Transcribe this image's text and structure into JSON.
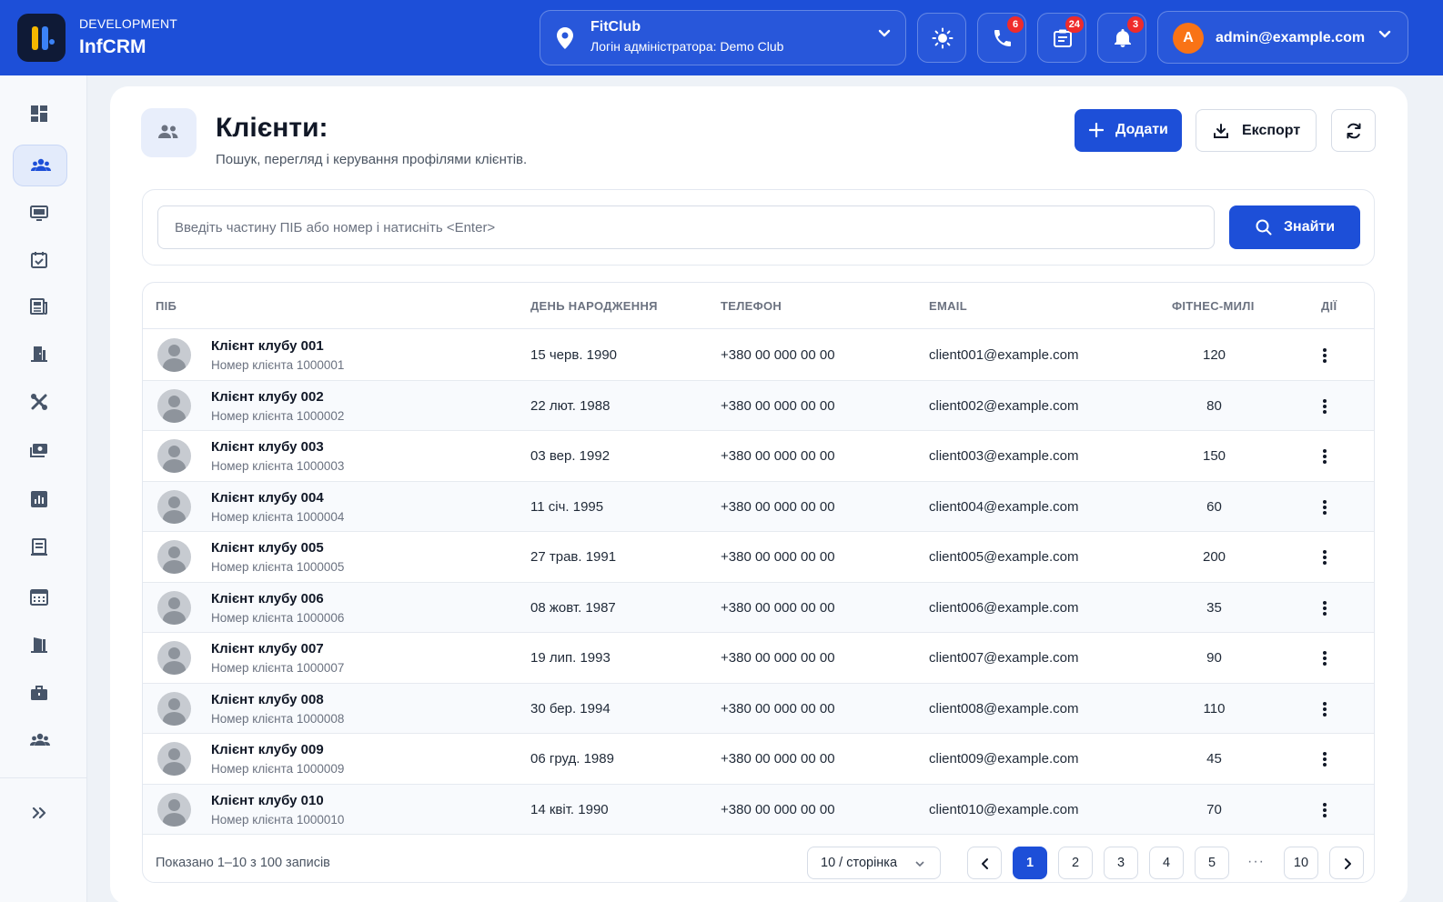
{
  "app": {
    "env_label": "DEVELOPMENT",
    "brand": "InfCRM"
  },
  "club_selector": {
    "name": "FitClub",
    "subtitle": "Логін адміністратора: Demo Club"
  },
  "header_actions": {
    "phone_badge": "6",
    "tasks_badge": "24",
    "notifications_badge": "3"
  },
  "user": {
    "initial": "A",
    "email": "admin@example.com"
  },
  "page": {
    "title": "Клієнти:",
    "subtitle": "Пошук, перегляд і керування профілями клієнтів.",
    "add_label": "Додати",
    "export_label": "Експорт"
  },
  "search": {
    "placeholder": "Введіть частину ПІБ або номер і натисніть <Enter>",
    "value": "",
    "button_label": "Знайти"
  },
  "table": {
    "columns": [
      "ПІБ",
      "ДЕНЬ НАРОДЖЕННЯ",
      "ТЕЛЕФОН",
      "EMAIL",
      "ФІТНЕС-МИЛІ",
      "ДІЇ"
    ],
    "rows": [
      {
        "name": "Клієнт клубу 001",
        "number": "Номер клієнта 1000001",
        "birthday": "15 черв. 1990",
        "phone": "+380 00 000 00 00",
        "email": "client001@example.com",
        "miles": "120"
      },
      {
        "name": "Клієнт клубу 002",
        "number": "Номер клієнта 1000002",
        "birthday": "22 лют. 1988",
        "phone": "+380 00 000 00 00",
        "email": "client002@example.com",
        "miles": "80"
      },
      {
        "name": "Клієнт клубу 003",
        "number": "Номер клієнта 1000003",
        "birthday": "03 вер. 1992",
        "phone": "+380 00 000 00 00",
        "email": "client003@example.com",
        "miles": "150"
      },
      {
        "name": "Клієнт клубу 004",
        "number": "Номер клієнта 1000004",
        "birthday": "11 січ. 1995",
        "phone": "+380 00 000 00 00",
        "email": "client004@example.com",
        "miles": "60"
      },
      {
        "name": "Клієнт клубу 005",
        "number": "Номер клієнта 1000005",
        "birthday": "27 трав. 1991",
        "phone": "+380 00 000 00 00",
        "email": "client005@example.com",
        "miles": "200"
      },
      {
        "name": "Клієнт клубу 006",
        "number": "Номер клієнта 1000006",
        "birthday": "08 жовт. 1987",
        "phone": "+380 00 000 00 00",
        "email": "client006@example.com",
        "miles": "35"
      },
      {
        "name": "Клієнт клубу 007",
        "number": "Номер клієнта 1000007",
        "birthday": "19 лип. 1993",
        "phone": "+380 00 000 00 00",
        "email": "client007@example.com",
        "miles": "90"
      },
      {
        "name": "Клієнт клубу 008",
        "number": "Номер клієнта 1000008",
        "birthday": "30 бер. 1994",
        "phone": "+380 00 000 00 00",
        "email": "client008@example.com",
        "miles": "110"
      },
      {
        "name": "Клієнт клубу 009",
        "number": "Номер клієнта 1000009",
        "birthday": "06 груд. 1989",
        "phone": "+380 00 000 00 00",
        "email": "client009@example.com",
        "miles": "45"
      },
      {
        "name": "Клієнт клубу 010",
        "number": "Номер клієнта 1000010",
        "birthday": "14 квіт. 1990",
        "phone": "+380 00 000 00 00",
        "email": "client010@example.com",
        "miles": "70"
      }
    ]
  },
  "footer": {
    "shown_text": "Показано 1–10 з 100 записів",
    "per_page": "10 / сторінка",
    "pages": [
      "1",
      "2",
      "3",
      "4",
      "5"
    ],
    "ellipsis": "···",
    "last_page": "10",
    "current_page": "1"
  },
  "sidebar": {
    "icons": [
      "dashboard-icon",
      "clients-icon",
      "monitor-icon",
      "calendar-check-icon",
      "news-icon",
      "door-icon",
      "tools-icon",
      "payment-icon",
      "chart-icon",
      "receipt-icon",
      "calendar-icon",
      "door-open-icon",
      "briefcase-icon",
      "team-icon"
    ],
    "active": "clients-icon"
  },
  "colors": {
    "primary": "#1d4fd8",
    "badge": "#ef2b2b",
    "avatar": "#f97316"
  }
}
